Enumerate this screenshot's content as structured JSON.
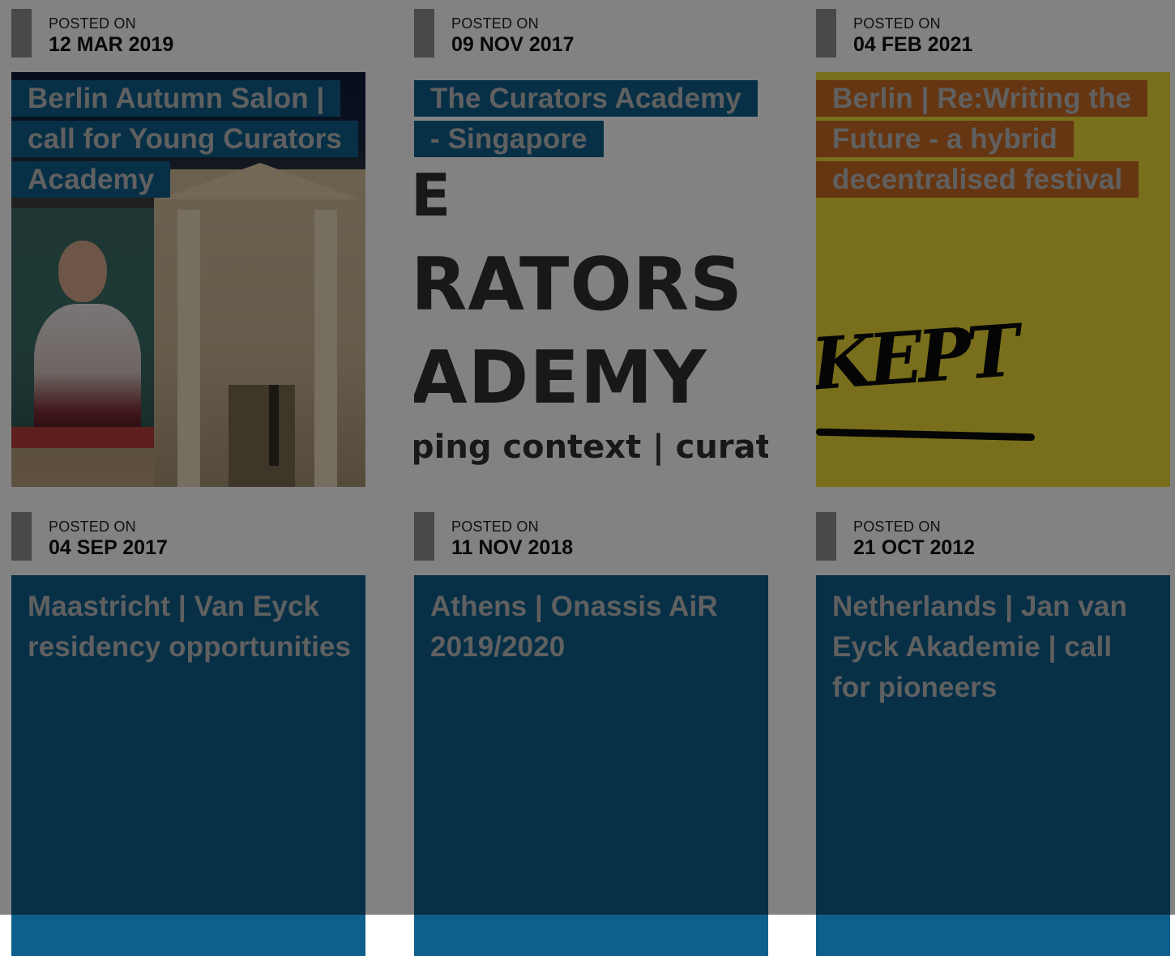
{
  "posts": [
    {
      "posted_label": "POSTED ON",
      "date": "12 MAR 2019",
      "title_lines": [
        "Berlin Autumn Salon |",
        "call for Young Curators",
        "Academy"
      ],
      "art": "berlin-building"
    },
    {
      "posted_label": "POSTED ON",
      "date": "09 NOV 2017",
      "title_lines": [
        "The Curators Academy",
        "- Singapore"
      ],
      "art": "curators-academy-graphic",
      "art_text": {
        "line1": "E",
        "line2": "RATORS",
        "line3": "ADEMY",
        "line4": "ping context | curation"
      }
    },
    {
      "posted_label": "POSTED ON",
      "date": "04 FEB 2021",
      "title_lines": [
        "Berlin | Re:Writing the",
        "Future - a hybrid",
        "decentralised festival"
      ],
      "art": "yellow-hand-lettering",
      "art_text": {
        "word": "KEPT"
      }
    },
    {
      "posted_label": "POSTED ON",
      "date": "04 SEP 2017",
      "title": "Maastricht | Van Eyck residency opportunities"
    },
    {
      "posted_label": "POSTED ON",
      "date": "11 NOV 2018",
      "title": "Athens | Onassis AiR 2019/2020"
    },
    {
      "posted_label": "POSTED ON",
      "date": "21 OCT 2012",
      "title": "Netherlands | Jan van Eyck Akademie | call for pioneers"
    }
  ],
  "colors": {
    "card_blue": "#0e5f8c",
    "card_orange": "#c86a24",
    "yellow_art": "#ecd835",
    "date_bar": "#8f8f8f",
    "overlay": "rgba(0,0,0,0.49)"
  }
}
